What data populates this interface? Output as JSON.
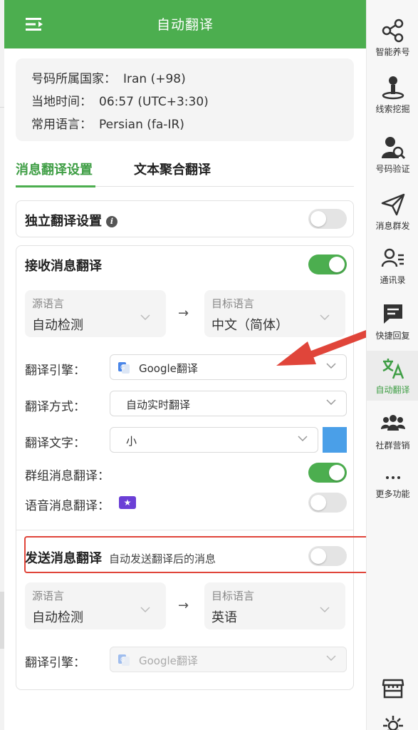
{
  "header": {
    "title": "自动翻译"
  },
  "info": {
    "country_label": "号码所属国家：",
    "country_value": "Iran (+98)",
    "time_label": "当地时间：",
    "time_value": "06:57 (UTC+3:30)",
    "language_label": "常用语言：",
    "language_value": "Persian (fa-IR)"
  },
  "tabs": [
    {
      "label": "消息翻译设置",
      "active": true
    },
    {
      "label": "文本聚合翻译",
      "active": false
    }
  ],
  "independent": {
    "title": "独立翻译设置",
    "info_icon": "i",
    "enabled": false
  },
  "receive": {
    "title": "接收消息翻译",
    "enabled": true,
    "source_label": "源语言",
    "source_value": "自动检测",
    "arrow": "→",
    "target_label": "目标语言",
    "target_value": "中文（简体）",
    "engine_label": "翻译引擎：",
    "engine_value": "Google翻译",
    "mode_label": "翻译方式：",
    "mode_value": "自动实时翻译",
    "font_label": "翻译文字：",
    "font_value": "小",
    "font_color": "#4a9fe8",
    "group_label": "群组消息翻译：",
    "group_enabled": true,
    "voice_label": "语音消息翻译：",
    "voice_badge": "★",
    "voice_enabled": false
  },
  "send": {
    "title": "发送消息翻译",
    "subtitle": "自动发送翻译后的消息",
    "enabled": false,
    "source_label": "源语言",
    "source_value": "自动检测",
    "arrow": "→",
    "target_label": "目标语言",
    "target_value": "英语",
    "engine_label": "翻译引擎：",
    "engine_value": "Google翻译"
  },
  "sidebar": {
    "items": [
      {
        "label": "智能养号",
        "icon": "share-nodes-icon"
      },
      {
        "label": "线索挖掘",
        "icon": "user-pin-icon"
      },
      {
        "label": "号码验证",
        "icon": "user-search-icon"
      },
      {
        "label": "消息群发",
        "icon": "paper-plane-icon"
      },
      {
        "label": "通讯录",
        "icon": "contacts-icon"
      },
      {
        "label": "快捷回复",
        "icon": "chat-bubble-icon"
      },
      {
        "label": "自动翻译",
        "icon": "translate-icon",
        "active": true
      },
      {
        "label": "社群营销",
        "icon": "group-icon"
      },
      {
        "label": "更多功能",
        "icon": "more-icon"
      }
    ]
  },
  "colors": {
    "brand_green": "#4cae4f",
    "annotation_red": "#e0453a"
  }
}
